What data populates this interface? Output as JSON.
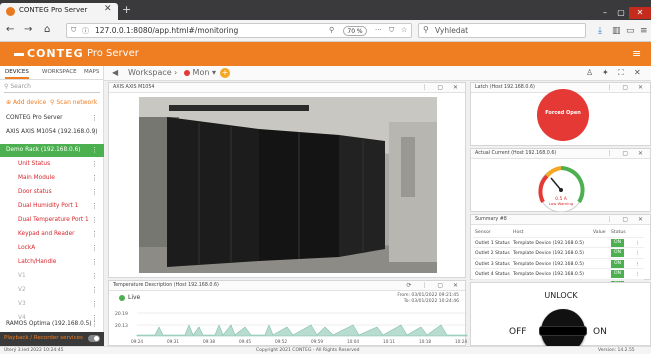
{
  "browser": {
    "tab_title": "CONTEG Pro Server",
    "url": "127.0.0.1:8080/app.html#/monitoring",
    "zoom": "70 %",
    "search_placeholder": "Vyhledat"
  },
  "app": {
    "logo": "CONTEG",
    "name": "Pro Server"
  },
  "sidebar": {
    "tabs": [
      "DEVICES",
      "WORKSPACE",
      "MAPS"
    ],
    "search_placeholder": "Search",
    "add_device": "Add device",
    "scan_network": "Scan network",
    "items": [
      {
        "label": "CONTEG Pro Server",
        "style": "normal"
      },
      {
        "label": "AXIS AXIS M1054 (192.168.0.9)",
        "style": "normal"
      },
      {
        "label": "Demo Rack (192.168.0.6)",
        "style": "sel"
      },
      {
        "label": "Unit Status",
        "style": "red"
      },
      {
        "label": "Main Module",
        "style": "red"
      },
      {
        "label": "Door status",
        "style": "red"
      },
      {
        "label": "Dual Humidity Port 1",
        "style": "red"
      },
      {
        "label": "Dual Temperature Port 1",
        "style": "red"
      },
      {
        "label": "Keypad and Reader",
        "style": "red"
      },
      {
        "label": "LockA",
        "style": "red"
      },
      {
        "label": "Latch/Handle",
        "style": "red"
      },
      {
        "label": "V1",
        "style": "grey"
      },
      {
        "label": "V2",
        "style": "grey"
      },
      {
        "label": "V3",
        "style": "grey"
      },
      {
        "label": "V4",
        "style": "grey"
      },
      {
        "label": "RAMOS Optima (192.168.0.5)",
        "style": "normal"
      }
    ],
    "footer": "Playback / Recorder services"
  },
  "workspace": {
    "label": "Workspace",
    "current": "Mon"
  },
  "panels": {
    "camera": {
      "title": "AXIS AXIS M1054"
    },
    "temperature": {
      "title": "Temperature Description (Host 192.168.0.6)",
      "live": "Live",
      "from": "From: 03/01/2022 09:21:45",
      "to": "To: 03/01/2022 10:24:46",
      "ticks_y": [
        "20.19",
        "20.13"
      ],
      "ticks_x": [
        "09:24",
        "09:31",
        "09:38",
        "09:45",
        "09:52",
        "09:59",
        "10:04",
        "10:11",
        "10:18",
        "10:24"
      ]
    },
    "alert": {
      "title": "Latch (Host 192.168.0.6)",
      "label": "Forced Open"
    },
    "gauge": {
      "title": "Actual Current (Host 192.168.0.6)",
      "value_text": "0.5 A",
      "sub_text": "Low Warning"
    },
    "summary": {
      "title": "Summary #8",
      "headers": [
        "Sensor",
        "Host",
        "Value",
        "Status"
      ],
      "rows": [
        {
          "sensor": "Outlet 1 Status",
          "host": "Template Device (192.168.0.5)",
          "value": "",
          "status": "ON"
        },
        {
          "sensor": "Outlet 2 Status",
          "host": "Template Device (192.168.0.5)",
          "value": "",
          "status": "ON"
        },
        {
          "sensor": "Outlet 3 Status",
          "host": "Template Device (192.168.0.5)",
          "value": "",
          "status": "ON"
        },
        {
          "sensor": "Outlet 4 Status",
          "host": "Template Device (192.168.0.5)",
          "value": "",
          "status": "ON"
        },
        {
          "sensor": "Outlet 5 Status",
          "host": "Template Device (192.168.0.5)",
          "value": "",
          "status": "ON"
        }
      ]
    },
    "unlock": {
      "title": "UNLOCK",
      "off": "OFF",
      "on": "ON"
    }
  },
  "status": {
    "left": "Úterý 3.led 2022 10:24:45",
    "center": "Copyright 2021 CONTEG - All Rights Reserved",
    "right": "Version: 14.2.55"
  },
  "colors": {
    "brand": "#ef7d22",
    "ok": "#4caf50",
    "alarm": "#e53935"
  }
}
